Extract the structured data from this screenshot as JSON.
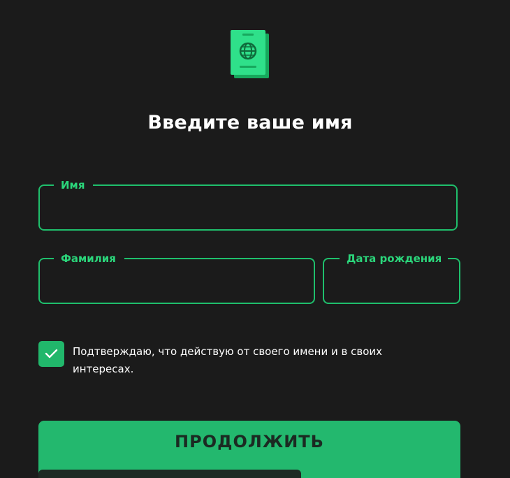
{
  "header": {
    "icon": "passport-icon",
    "title": "Введите ваше имя"
  },
  "form": {
    "first_name": {
      "label": "Имя",
      "value": ""
    },
    "last_name": {
      "label": "Фамилия",
      "value": ""
    },
    "birth_date": {
      "label": "Дата рождения",
      "value": ""
    }
  },
  "consent": {
    "checked": true,
    "icon": "checkmark-icon",
    "text": "Подтверждаю, что действую от своего имени и в своих интересах."
  },
  "actions": {
    "continue_label": "ПРОДОЛЖИТЬ"
  },
  "colors": {
    "background": "#1b1b1b",
    "accent": "#23b86e",
    "accent_text": "#2bd67b",
    "button_text": "#1b2a22"
  }
}
